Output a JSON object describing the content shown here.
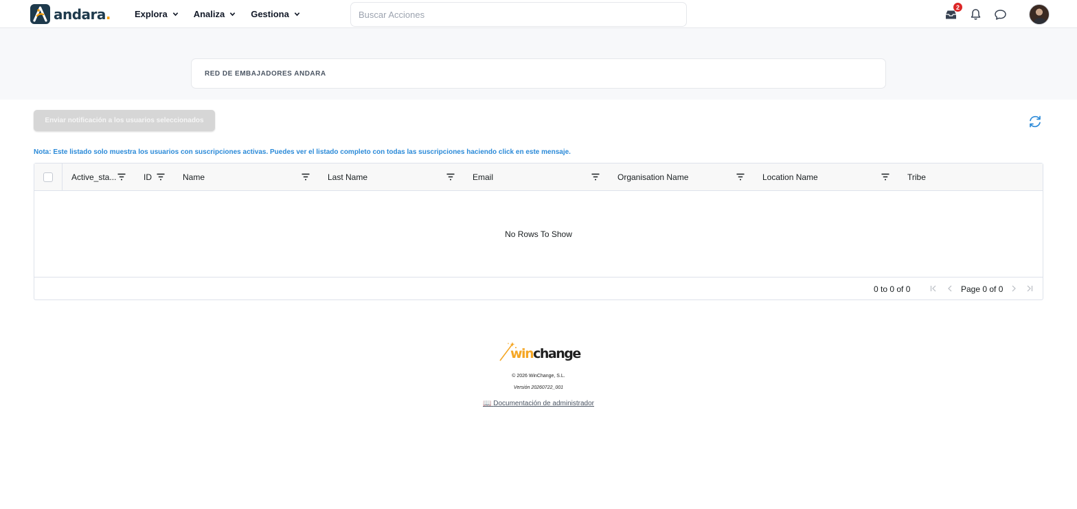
{
  "brand": {
    "name": "andara",
    "dot": ".",
    "accent": "#f59e0b",
    "primary": "#1e3a4c",
    "logo_icon": "andara-logo-icon"
  },
  "nav": [
    {
      "label": "Explora",
      "icon": "chevron-down-icon"
    },
    {
      "label": "Analiza",
      "icon": "chevron-down-icon"
    },
    {
      "label": "Gestiona",
      "icon": "chevron-down-icon"
    }
  ],
  "search": {
    "placeholder": "Buscar Acciones",
    "value": ""
  },
  "top_icons": {
    "inbox": {
      "icon": "inbox-icon",
      "badge": "2",
      "badge_color": "#dc2626"
    },
    "notifications": {
      "icon": "bell-icon"
    },
    "messages": {
      "icon": "chat-bubble-icon"
    },
    "avatar": {
      "icon": "user-avatar"
    }
  },
  "page": {
    "title": "RED DE EMBAJADORES ANDARA"
  },
  "actions": {
    "notify_label": "Enviar notificación a los usuarios seleccionados",
    "refresh_icon": "refresh-icon",
    "link_color": "#2b8ad8"
  },
  "note": "Nota: Este listado solo muestra los usuarios con suscripciones activas. Puedes ver el listado completo con todas las suscripciones haciendo click en este mensaje.",
  "grid": {
    "columns": [
      "Active_sta...",
      "ID",
      "Name",
      "Last Name",
      "Email",
      "Organisation Name",
      "Location Name",
      "Tribe"
    ],
    "empty_text": "No Rows To Show",
    "range_text": "0 to 0 of 0",
    "page_text": "Page 0 of 0"
  },
  "footer": {
    "logo": {
      "win": "win",
      "change": "change"
    },
    "copyright": "© 2026 WinChange, S.L.",
    "version": "Versión 20260722_001",
    "docs_icon": "📖",
    "docs_label": "Documentación de administrador"
  }
}
